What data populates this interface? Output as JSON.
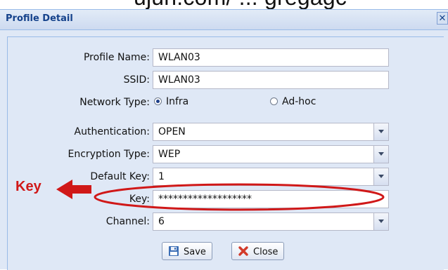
{
  "top_caption": "ujun.com/ ... gregagc",
  "window": {
    "title": "Profile Detail",
    "close_glyph": "✕"
  },
  "form": {
    "profile_name": {
      "label": "Profile Name:",
      "value": "WLAN03"
    },
    "ssid": {
      "label": "SSID:",
      "value": "WLAN03"
    },
    "network_type": {
      "label": "Network Type:",
      "options": [
        "Infra",
        "Ad-hoc"
      ],
      "selected": "Infra"
    },
    "authentication": {
      "label": "Authentication:",
      "value": "OPEN"
    },
    "encryption_type": {
      "label": "Encryption Type:",
      "value": "WEP"
    },
    "default_key": {
      "label": "Default Key:",
      "value": "1"
    },
    "key": {
      "label": "Key:",
      "value": "*******************"
    },
    "channel": {
      "label": "Channel:",
      "value": "6"
    }
  },
  "buttons": {
    "save": "Save",
    "close": "Close"
  },
  "annotation": {
    "label": "Key",
    "color": "#d01818"
  },
  "colors": {
    "panel_bg": "#dfe8f6",
    "title_text": "#15428b",
    "border": "#99bbe8"
  }
}
